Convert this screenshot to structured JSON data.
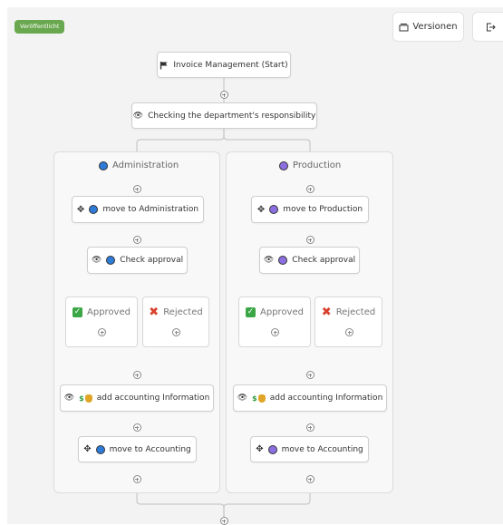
{
  "status_badge": "Veröffentlicht",
  "toolbar": {
    "versions_label": "Versionen"
  },
  "start_node": "Invoice Management (Start)",
  "check_node": "Checking the department's responsibility",
  "lanes": [
    {
      "title": "Administration",
      "color": "#2f7bd8",
      "move_to": "move to Administration",
      "approval": "Check approval",
      "approved": "Approved",
      "rejected": "Rejected",
      "accounting_info": "add accounting Information",
      "move_accounting": "move to Accounting"
    },
    {
      "title": "Production",
      "color": "#8b6fe0",
      "move_to": "move to Production",
      "approval": "Check approval",
      "approved": "Approved",
      "rejected": "Rejected",
      "accounting_info": "add accounting Information",
      "move_accounting": "move to Accounting"
    }
  ],
  "icons": [
    "flag-icon",
    "gateway-icon",
    "move-icon",
    "dollar-icon",
    "money-bag-icon",
    "check-icon",
    "x-icon",
    "versions-icon",
    "exit-icon",
    "add-step-icon"
  ]
}
